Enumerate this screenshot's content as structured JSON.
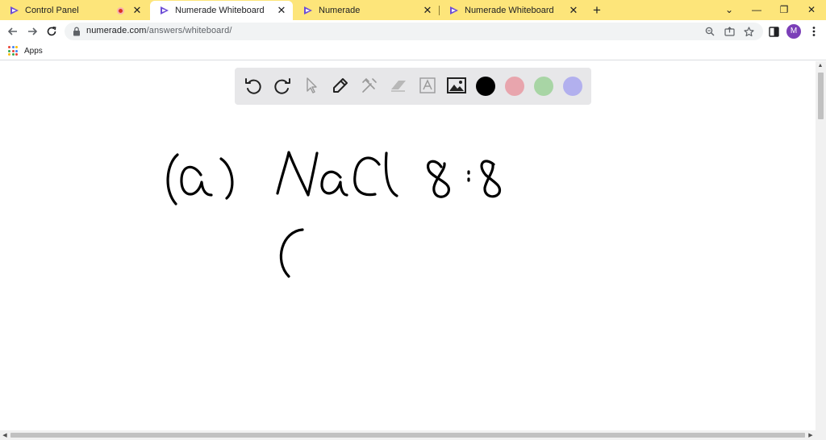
{
  "tabs": [
    {
      "title": "Control Panel",
      "recording": true
    },
    {
      "title": "Numerade Whiteboard",
      "active": true
    },
    {
      "title": "Numerade"
    },
    {
      "title": "Numerade Whiteboard"
    }
  ],
  "tab_close_glyph": "✕",
  "new_tab_glyph": "+",
  "window_controls": {
    "dropdown": "⌄",
    "minimize": "—",
    "restore": "❐",
    "close": "✕"
  },
  "address_bar": {
    "host": "numerade.com",
    "path": "/answers/whiteboard/"
  },
  "profile_initial": "M",
  "bookmarks": {
    "apps_label": "Apps"
  },
  "whiteboard": {
    "tools": [
      "undo-icon",
      "redo-icon",
      "pointer-icon",
      "pen-icon",
      "clear-tools-icon",
      "eraser-icon",
      "text-icon",
      "image-icon"
    ],
    "colors": [
      "#000000",
      "#e8a5ad",
      "#a8d5a5",
      "#b2b0ee"
    ],
    "handwritten_content": "(a) NaCl 8:8 ("
  },
  "theme": {
    "tabstrip": "#fde57a",
    "favicon": "#6c4dd6",
    "ink": "#000000"
  }
}
